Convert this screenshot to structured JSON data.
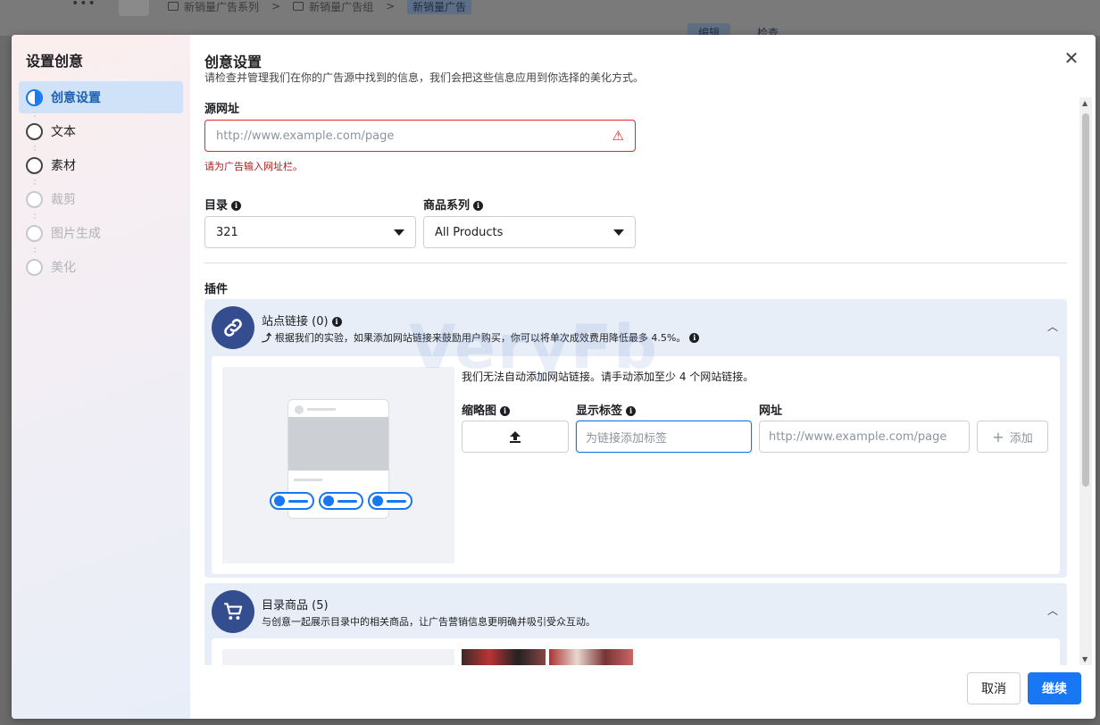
{
  "background": {
    "breadcrumbs": [
      "新销量广告系列",
      "新销量广告组",
      "新销量广告"
    ],
    "tabs": [
      "编辑",
      "检查"
    ]
  },
  "sidebar": {
    "title": "设置创意",
    "steps": [
      {
        "label": "创意设置",
        "state": "active"
      },
      {
        "label": "文本",
        "state": "enabled"
      },
      {
        "label": "素材",
        "state": "enabled"
      },
      {
        "label": "裁剪",
        "state": "disabled"
      },
      {
        "label": "图片生成",
        "state": "disabled"
      },
      {
        "label": "美化",
        "state": "disabled"
      }
    ]
  },
  "header": {
    "title": "创意设置",
    "subtitle": "请检查并管理我们在你的广告源中找到的信息，我们会把这些信息应用到你选择的美化方式。"
  },
  "source_url": {
    "label": "源网址",
    "placeholder": "http://www.example.com/page",
    "error": "请为广告输入网址栏。"
  },
  "catalog": {
    "label": "目录",
    "value": "321"
  },
  "product_set": {
    "label": "商品系列",
    "value": "All Products"
  },
  "plugins": {
    "label": "插件",
    "site_links": {
      "title": "站点链接 (0)",
      "description": "根据我们的实验，如果添加网站链接来鼓励用户购买，你可以将单次成效费用降低最多 4.5%。",
      "message": "我们无法自动添加网站链接。请手动添加至少 4 个网站链接。",
      "thumbnail_label": "缩略图",
      "display_tag_label": "显示标签",
      "display_tag_placeholder": "为链接添加标签",
      "url_label": "网址",
      "url_placeholder": "http://www.example.com/page",
      "add_button": "添加"
    },
    "catalog_items": {
      "title": "目录商品 (5)",
      "description": "与创意一起展示目录中的相关商品，让广告营销信息更明确并吸引受众互动。"
    }
  },
  "footer": {
    "cancel": "取消",
    "continue": "继续"
  },
  "watermark": "VeryFb",
  "colors": {
    "accent": "#1877f2",
    "error": "#e02929",
    "panel": "#e7eef8",
    "icon_bg": "#344d8f"
  }
}
